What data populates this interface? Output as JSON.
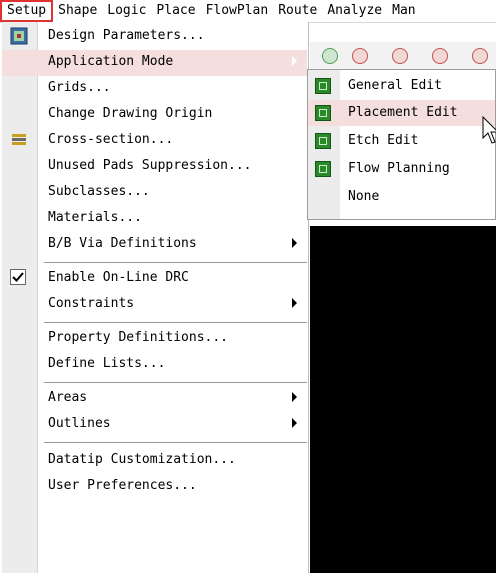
{
  "menubar": {
    "items": [
      "Setup",
      "Shape",
      "Logic",
      "Place",
      "FlowPlan",
      "Route",
      "Analyze",
      "Man"
    ]
  },
  "setup_menu": {
    "items": [
      {
        "label": "Design Parameters...",
        "icon": "design-parameters-icon"
      },
      {
        "label": "Application Mode",
        "submenu": true
      },
      {
        "label": "Grids..."
      },
      {
        "label": "Change Drawing Origin"
      },
      {
        "label": "Cross-section...",
        "icon": "cross-section-icon"
      },
      {
        "label": "Unused Pads Suppression..."
      },
      {
        "label": "Subclasses..."
      },
      {
        "label": "Materials..."
      },
      {
        "label": "B/B Via Definitions",
        "submenu": true
      },
      {
        "label": "Enable On-Line DRC",
        "checked": true
      },
      {
        "label": "Constraints",
        "submenu": true
      },
      {
        "label": "Property Definitions..."
      },
      {
        "label": "Define Lists..."
      },
      {
        "label": "Areas",
        "submenu": true
      },
      {
        "label": "Outlines",
        "submenu": true
      },
      {
        "label": "Datatip Customization..."
      },
      {
        "label": "User Preferences..."
      }
    ]
  },
  "submenu": {
    "items": [
      {
        "label": "General Edit",
        "icon": "general-edit-icon"
      },
      {
        "label": "Placement Edit",
        "icon": "placement-edit-icon"
      },
      {
        "label": "Etch Edit",
        "icon": "etch-edit-icon"
      },
      {
        "label": "Flow Planning",
        "icon": "flow-planning-icon"
      },
      {
        "label": "None"
      }
    ]
  },
  "colors": {
    "highlight": "#f4dede",
    "active_border": "#dd3333",
    "canvas": "#000000",
    "mode_icon": "#2a8a2a"
  }
}
